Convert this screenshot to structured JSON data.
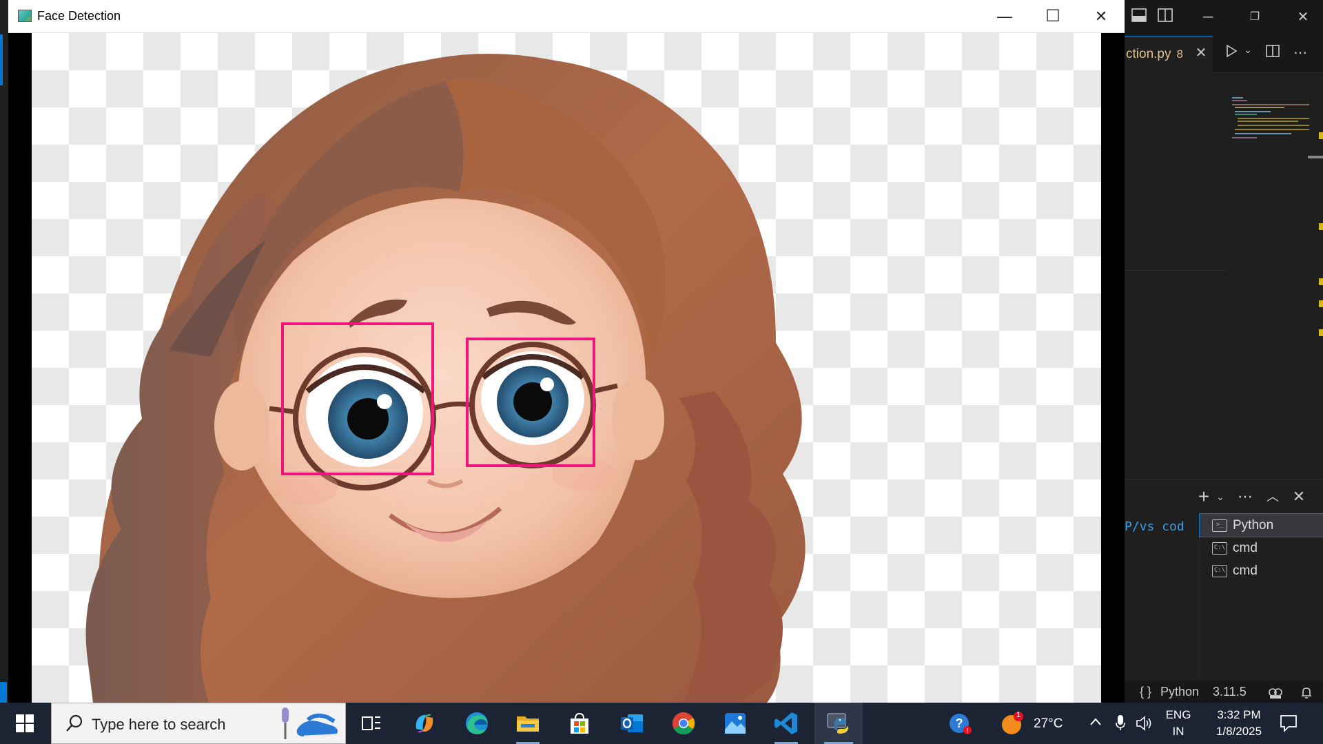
{
  "cv_window": {
    "title": "Face Detection",
    "minimize_glyph": "—",
    "maximize_glyph": "☐",
    "close_glyph": "✕",
    "detections_label": "eye detections",
    "box_color": "#f0147c"
  },
  "vscode": {
    "editor_tab": "ction.py",
    "problem_count": "8",
    "terminal_path": "P/vs cod",
    "terminals": [
      {
        "name": "Python",
        "icon": "terminal-icon",
        "active": true
      },
      {
        "name": "cmd",
        "icon": "cmd-icon",
        "active": false
      },
      {
        "name": "cmd",
        "icon": "cmd-icon",
        "active": false
      }
    ],
    "status": {
      "language_braces": "{ }",
      "language": "Python",
      "version": "3.11.5"
    }
  },
  "taskbar": {
    "search_placeholder": "Type here to search",
    "apps": [
      {
        "name": "task-view-icon"
      },
      {
        "name": "copilot-icon"
      },
      {
        "name": "edge-icon"
      },
      {
        "name": "file-explorer-icon"
      },
      {
        "name": "microsoft-store-icon"
      },
      {
        "name": "outlook-icon"
      },
      {
        "name": "chrome-icon"
      },
      {
        "name": "photos-icon"
      },
      {
        "name": "vscode-icon"
      },
      {
        "name": "python-icon"
      }
    ],
    "weather_badge": "1",
    "temperature": "27°C",
    "language": "ENG",
    "region": "IN",
    "time": "3:32 PM",
    "date": "1/8/2025"
  }
}
